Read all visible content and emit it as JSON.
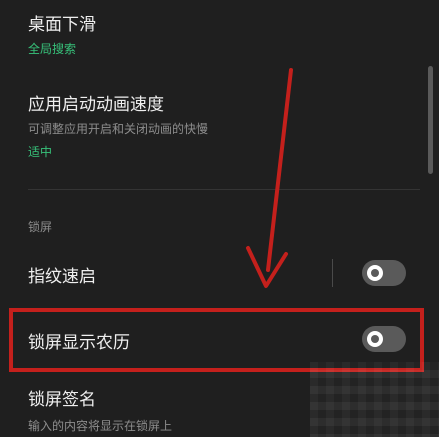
{
  "settings": {
    "desktop_swipe": {
      "title": "桌面下滑",
      "value": "全局搜索"
    },
    "app_anim": {
      "title": "应用启动动画速度",
      "desc": "可调整应用开启和关闭动画的快慢",
      "value": "适中"
    },
    "lock_section": {
      "label": "锁屏"
    },
    "fingerprint": {
      "title": "指纹速启",
      "enabled": false
    },
    "lunar": {
      "title": "锁屏显示农历",
      "enabled": false
    },
    "signature": {
      "title": "锁屏签名",
      "desc": "输入的内容将显示在锁屏上"
    }
  },
  "colors": {
    "background": "#1f1f1f",
    "accent_green": "#37c27a",
    "annotation_red": "#c4201c",
    "toggle_off": "#5a5a5a"
  }
}
